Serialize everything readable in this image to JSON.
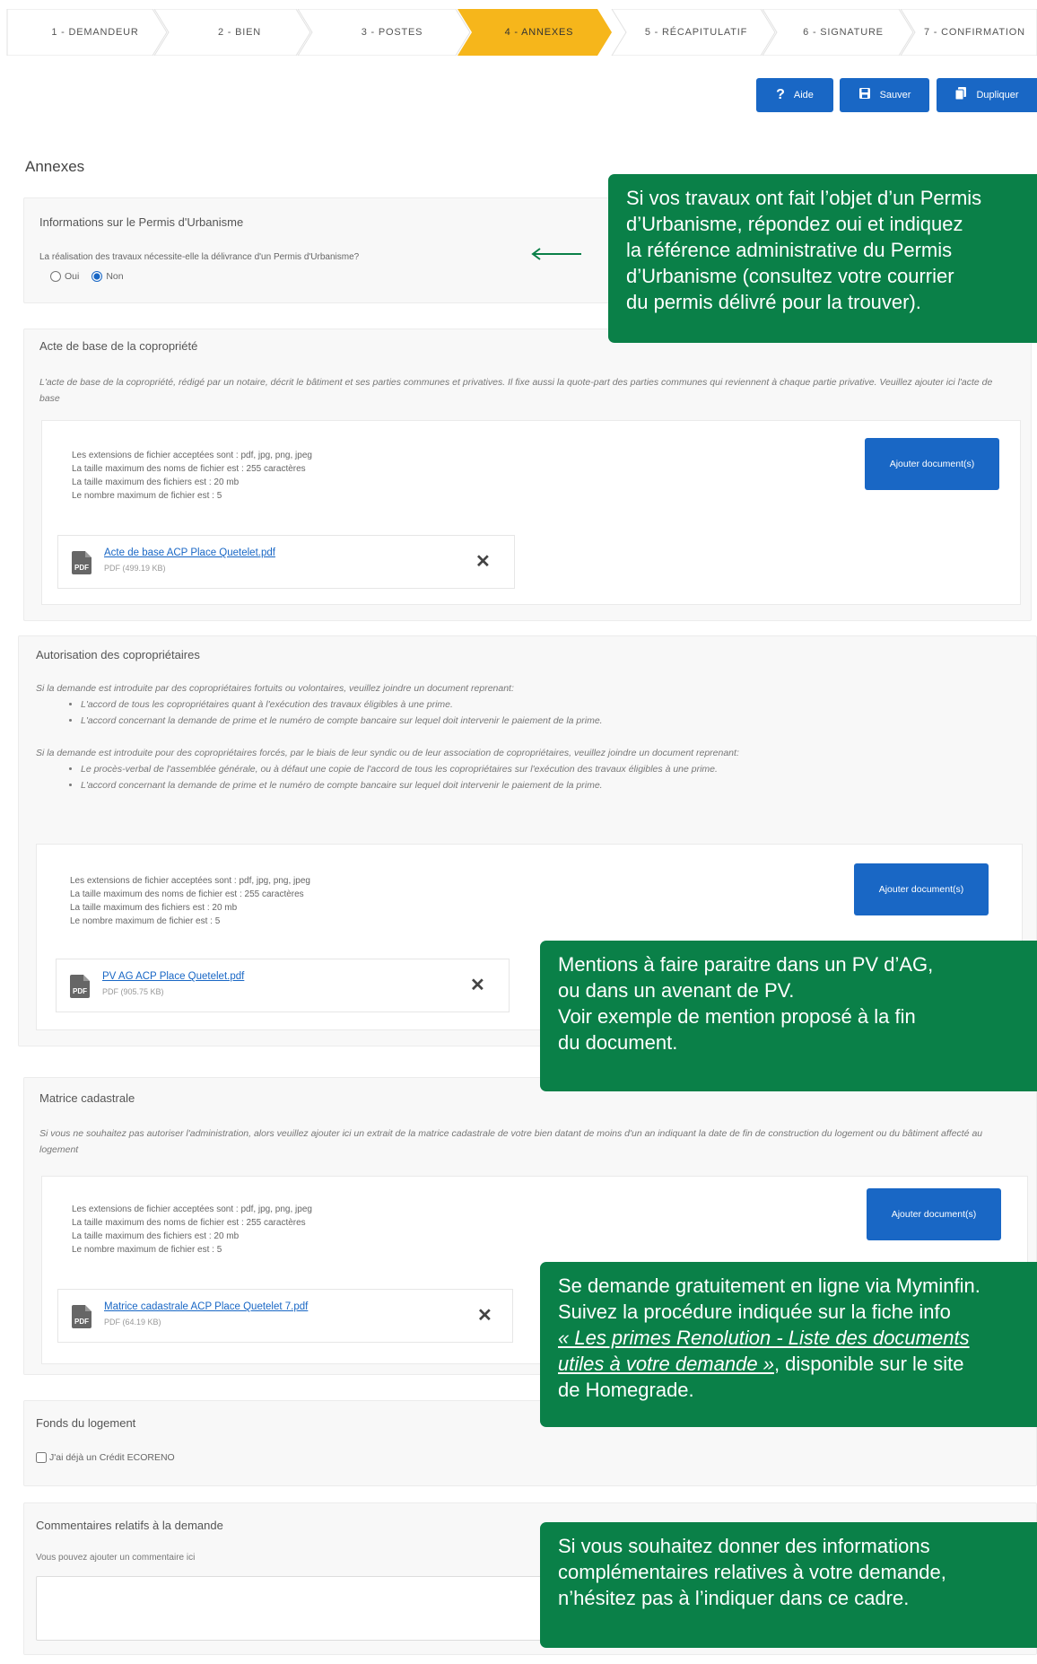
{
  "steps": [
    {
      "label": "1 - DEMANDEUR"
    },
    {
      "label": "2 - BIEN"
    },
    {
      "label": "3 - POSTES"
    },
    {
      "label": "4 - ANNEXES",
      "active": true
    },
    {
      "label": "5 - RÉCAPITULATIF"
    },
    {
      "label": "6 - SIGNATURE"
    },
    {
      "label": "7 - CONFIRMATION"
    }
  ],
  "toolbar": {
    "help": "Aide",
    "save": "Sauver",
    "duplicate": "Dupliquer"
  },
  "page_title": "Annexes",
  "permis": {
    "title": "Informations sur le Permis d'Urbanisme",
    "question": "La réalisation des travaux nécessite-elle la délivrance d'un Permis d'Urbanisme?",
    "opt_yes": "Oui",
    "opt_no": "Non",
    "selected": "Non"
  },
  "acte": {
    "title": "Acte de base de la copropriété",
    "desc": "L'acte de base de la copropriété, rédigé par un notaire, décrit le bâtiment et ses parties communes et privatives. Il fixe aussi la quote-part des parties communes qui reviennent à chaque partie privative. Veuillez ajouter ici l'acte de base",
    "file_name": "Acte de base ACP Place Quetelet.pdf",
    "file_meta": "PDF (499.19 KB)"
  },
  "rules": {
    "ext": "Les extensions de fichier acceptées sont : pdf, jpg, png, jpeg",
    "name_len": "La taille maximum des noms de fichier est : 255 caractères",
    "size": "La taille maximum des fichiers est : 20 mb",
    "count": "Le nombre maximum de fichier est : 5"
  },
  "add_button": "Ajouter document(s)",
  "autorisation": {
    "title": "Autorisation des copropriétaires",
    "p1": "Si la demande est introduite par des copropriétaires fortuits ou volontaires, veuillez joindre un document reprenant:",
    "b1": "L'accord de tous les copropriétaires quant à l'exécution des travaux éligibles à une prime.",
    "b2": "L'accord concernant la demande de prime et le numéro de compte bancaire sur lequel doit intervenir le paiement de la prime.",
    "p2": "Si la demande est introduite pour des copropriétaires forcés, par le biais de leur syndic ou de leur association de copropriétaires, veuillez joindre un document reprenant:",
    "b3": "Le procès-verbal de l'assemblée générale, ou à défaut une copie de l'accord de tous les copropriétaires sur l'exécution des travaux éligibles à une prime.",
    "b4": "L'accord concernant la demande de prime et le numéro de compte bancaire sur lequel doit intervenir le paiement de la prime.",
    "file_name": "PV AG ACP Place Quetelet.pdf",
    "file_meta": "PDF (905.75 KB)"
  },
  "matrice": {
    "title": "Matrice cadastrale",
    "desc": "Si vous ne souhaitez pas autoriser l'administration, alors veuillez ajouter ici un extrait de la matrice cadastrale de votre bien datant de moins d'un an indiquant la date de fin de construction du logement ou du bâtiment affecté au logement",
    "file_name": "Matrice cadastrale ACP Place Quetelet 7.pdf",
    "file_meta": "PDF (64.19 KB)"
  },
  "fonds": {
    "title": "Fonds du logement",
    "checkbox": "J'ai déjà un Crédit ECORENO"
  },
  "comments": {
    "title": "Commentaires relatifs à la demande",
    "label": "Vous pouvez ajouter un commentaire ici",
    "value": ""
  },
  "tips": {
    "t1": [
      "Si vos travaux ont fait l’objet d’un Permis",
      "d’Urbanisme, répondez oui et indiquez",
      "la référence administrative du Permis",
      "d’Urbanisme (consultez votre courrier",
      "du permis délivré pour la trouver)."
    ],
    "t2": [
      "Mentions à faire paraitre dans un PV d’AG,",
      "ou dans un avenant de PV.",
      "Voir exemple de mention proposé à la fin",
      "du document."
    ],
    "t3_l1": "Se demande gratuitement en ligne via Myminfin.",
    "t3_l2": "Suivez la procédure indiquée sur la fiche info",
    "t3_link1": "« Les primes Renolution - Liste des documents",
    "t3_link2": "utiles à votre demande »",
    "t3_l3_rest": ", disponible sur le site",
    "t3_l4": "de Homegrade.",
    "t4": [
      "Si vous souhaitez donner des informations",
      "complémentaires relatives à votre demande,",
      "n’hésitez pas à l’indiquer dans ce cadre."
    ]
  },
  "colors": {
    "accent": "#1967c5",
    "step_active": "#f6b61b",
    "tip_bg": "#0a8048"
  }
}
